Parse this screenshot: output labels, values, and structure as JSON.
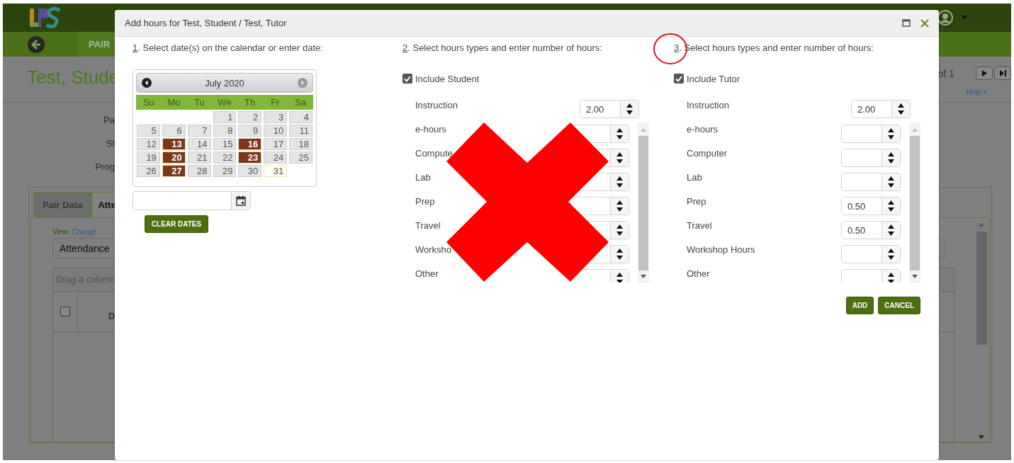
{
  "background_page": {
    "nav_tab": "PAIR",
    "title": "Test, Stude",
    "field_labels": [
      "Pa",
      "St",
      "Prog"
    ],
    "tabs": [
      {
        "label": "Pair Data",
        "selected": false
      },
      {
        "label": "Atte",
        "selected": true
      }
    ],
    "view_label": "View:",
    "view_link": "Change",
    "view_value": "Attendance",
    "group_hint": "Drag a column",
    "column_header": "D",
    "row_checked": false,
    "pager_text": "of 1",
    "help_link": "Help <"
  },
  "dialog": {
    "title": "Add hours for Test, Student / Test, Tutor",
    "step1": {
      "number": "1",
      "text": ". Select date(s) on the calendar or enter date:"
    },
    "calendar": {
      "month": "July 2020",
      "weekdays": [
        "Su",
        "Mo",
        "Tu",
        "We",
        "Th",
        "Fr",
        "Sa"
      ],
      "weeks": [
        [
          {
            "day": "1",
            "selected": false,
            "today": false
          },
          {
            "day": "2",
            "selected": false,
            "today": false
          },
          {
            "day": "3",
            "selected": false,
            "today": false
          },
          {
            "day": "4",
            "selected": false,
            "today": false
          }
        ],
        [
          {
            "day": "5",
            "selected": false,
            "today": false
          },
          {
            "day": "6",
            "selected": false,
            "today": false
          },
          {
            "day": "7",
            "selected": false,
            "today": false
          },
          {
            "day": "8",
            "selected": false,
            "today": false
          },
          {
            "day": "9",
            "selected": false,
            "today": false
          },
          {
            "day": "10",
            "selected": false,
            "today": false
          },
          {
            "day": "11",
            "selected": false,
            "today": false
          }
        ],
        [
          {
            "day": "12",
            "selected": false,
            "today": false
          },
          {
            "day": "13",
            "selected": true,
            "today": false
          },
          {
            "day": "14",
            "selected": false,
            "today": false
          },
          {
            "day": "15",
            "selected": false,
            "today": false
          },
          {
            "day": "16",
            "selected": true,
            "today": false
          },
          {
            "day": "17",
            "selected": false,
            "today": false
          },
          {
            "day": "18",
            "selected": false,
            "today": false
          }
        ],
        [
          {
            "day": "19",
            "selected": false,
            "today": false
          },
          {
            "day": "20",
            "selected": true,
            "today": false
          },
          {
            "day": "21",
            "selected": false,
            "today": false
          },
          {
            "day": "22",
            "selected": false,
            "today": false
          },
          {
            "day": "23",
            "selected": true,
            "today": false
          },
          {
            "day": "24",
            "selected": false,
            "today": false
          },
          {
            "day": "25",
            "selected": false,
            "today": false
          }
        ],
        [
          {
            "day": "26",
            "selected": false,
            "today": false
          },
          {
            "day": "27",
            "selected": true,
            "today": false
          },
          {
            "day": "28",
            "selected": false,
            "today": false
          },
          {
            "day": "29",
            "selected": false,
            "today": false
          },
          {
            "day": "30",
            "selected": false,
            "today": false
          },
          {
            "day": "31",
            "selected": false,
            "today": true
          }
        ]
      ]
    },
    "clear_button": "CLEAR DATES",
    "columns": [
      {
        "number": "2",
        "heading": ". Select hours types and enter number of hours:",
        "include_label": "Include Student",
        "include_checked": true,
        "annotation": {
          "kind": "cross"
        },
        "instruction": {
          "label": "Instruction",
          "value": "2.00"
        },
        "hours": [
          {
            "label": "e-hours"
          },
          {
            "label": "Compute"
          },
          {
            "label": "Lab"
          },
          {
            "label": "Prep"
          },
          {
            "label": "Travel"
          },
          {
            "label": "Worksho"
          },
          {
            "label": "Other"
          }
        ]
      },
      {
        "number": "3",
        "heading": ". Select hours types and enter number of hours:",
        "include_label": "Include Tutor",
        "include_checked": true,
        "annotation": {
          "kind": "circle"
        },
        "instruction": {
          "label": "Instruction",
          "value": "2.00"
        },
        "hours": [
          {
            "label": "e-hours"
          },
          {
            "label": "Computer"
          },
          {
            "label": "Lab"
          },
          {
            "label": "Prep",
            "value": "0.50"
          },
          {
            "label": "Travel",
            "value": "0.50"
          },
          {
            "label": "Workshop Hours"
          },
          {
            "label": "Other"
          }
        ]
      }
    ],
    "buttons": [
      "ADD",
      "CANCEL"
    ]
  }
}
